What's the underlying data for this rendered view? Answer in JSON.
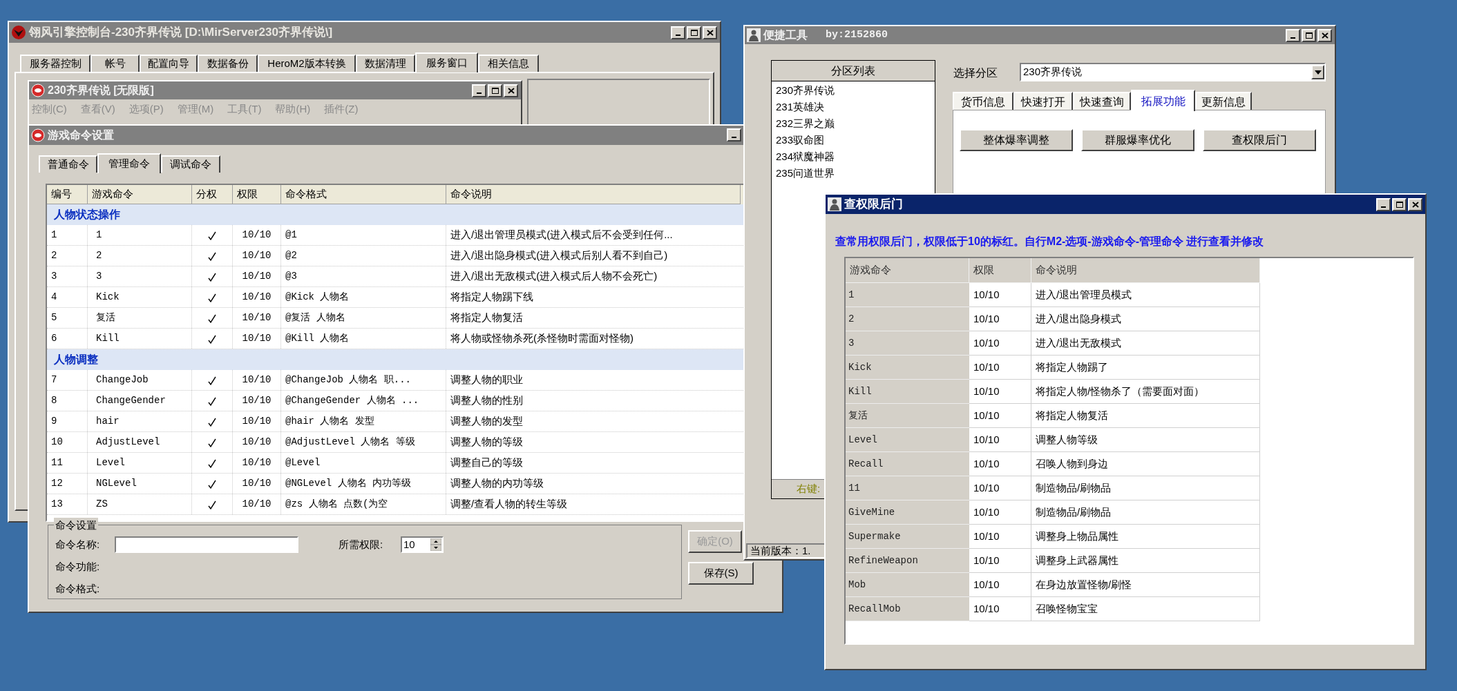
{
  "console_window": {
    "title": "翎风引擎控制台-230齐界传说 [D:\\MirServer230齐界传说\\]",
    "tabs": [
      {
        "label": "服务器控制",
        "selected": false
      },
      {
        "label": "帐号",
        "selected": false
      },
      {
        "label": "配置向导",
        "selected": false
      },
      {
        "label": "数据备份",
        "selected": false
      },
      {
        "label": "HeroM2版本转换",
        "selected": false
      },
      {
        "label": "数据清理",
        "selected": false
      },
      {
        "label": "服务窗口",
        "selected": true
      },
      {
        "label": "相关信息",
        "selected": false
      }
    ]
  },
  "server_window": {
    "title": "230齐界传说 [无限版]",
    "menu": [
      {
        "label": "控制(C)",
        "disabled": true
      },
      {
        "label": "查看(V)",
        "disabled": true
      },
      {
        "label": "选项(P)",
        "disabled": true
      },
      {
        "label": "管理(M)",
        "disabled": true
      },
      {
        "label": "工具(T)",
        "disabled": true
      },
      {
        "label": "帮助(H)",
        "disabled": true
      },
      {
        "label": "插件(Z)",
        "disabled": true
      }
    ]
  },
  "command_window": {
    "title": "游戏命令设置",
    "tabs": [
      {
        "label": "普通命令",
        "selected": false
      },
      {
        "label": "管理命令",
        "selected": true
      },
      {
        "label": "调试命令",
        "selected": false
      }
    ],
    "columns": [
      "编号",
      "游戏命令",
      "分权",
      "权限",
      "命令格式",
      "命令说明"
    ],
    "groups": [
      {
        "title": "人物状态操作",
        "rows": [
          {
            "id": "1",
            "command": "1",
            "split": true,
            "permission": "10/10",
            "format": "@1",
            "description": "进入/退出管理员模式(进入模式后不会受到任何..."
          },
          {
            "id": "2",
            "command": "2",
            "split": true,
            "permission": "10/10",
            "format": "@2",
            "description": "进入/退出隐身模式(进入模式后别人看不到自己)"
          },
          {
            "id": "3",
            "command": "3",
            "split": true,
            "permission": "10/10",
            "format": "@3",
            "description": "进入/退出无敌模式(进入模式后人物不会死亡)"
          },
          {
            "id": "4",
            "command": "Kick",
            "split": true,
            "permission": "10/10",
            "format": "@Kick 人物名",
            "description": "将指定人物踢下线"
          },
          {
            "id": "5",
            "command": "复活",
            "split": true,
            "permission": "10/10",
            "format": "@复活 人物名",
            "description": "将指定人物复活"
          },
          {
            "id": "6",
            "command": "Kill",
            "split": true,
            "permission": "10/10",
            "format": "@Kill 人物名",
            "description": "将人物或怪物杀死(杀怪物时需面对怪物)"
          }
        ]
      },
      {
        "title": "人物调整",
        "rows": [
          {
            "id": "7",
            "command": "ChangeJob",
            "split": true,
            "permission": "10/10",
            "format": "@ChangeJob 人物名 职...",
            "description": "调整人物的职业"
          },
          {
            "id": "8",
            "command": "ChangeGender",
            "split": true,
            "permission": "10/10",
            "format": "@ChangeGender 人物名 ...",
            "description": "调整人物的性别"
          },
          {
            "id": "9",
            "command": "hair",
            "split": true,
            "permission": "10/10",
            "format": "@hair 人物名 发型",
            "description": "调整人物的发型"
          },
          {
            "id": "10",
            "command": "AdjustLevel",
            "split": true,
            "permission": "10/10",
            "format": "@AdjustLevel 人物名 等级",
            "description": "调整人物的等级"
          },
          {
            "id": "11",
            "command": "Level",
            "split": true,
            "permission": "10/10",
            "format": "@Level",
            "description": "调整自己的等级"
          },
          {
            "id": "12",
            "command": "NGLevel",
            "split": true,
            "permission": "10/10",
            "format": "@NGLevel 人物名 内功等级",
            "description": "调整人物的内功等级"
          },
          {
            "id": "13",
            "command": "ZS",
            "split": true,
            "permission": "10/10",
            "format": "@zs 人物名 点数(为空",
            "description": "调整/查看人物的转生等级"
          }
        ]
      }
    ],
    "settings": {
      "legend": "命令设置",
      "name_label": "命令名称:",
      "permission_label": "所需权限:",
      "permission_value": "10",
      "function_label": "命令功能:",
      "format_label": "命令格式:"
    },
    "buttons": [
      {
        "label": "确定(O)",
        "disabled": true
      },
      {
        "label": "保存(S)",
        "disabled": false
      }
    ]
  },
  "tools_window": {
    "title": "便捷工具",
    "author": "by:2152860",
    "partition_list": {
      "header": "分区列表",
      "items": [
        "230齐界传说",
        "231英雄决",
        "232三界之巅",
        "233驭命图",
        "234狱魔神器",
        "235问道世界"
      ],
      "footer": "右键:"
    },
    "select_label": "选择分区",
    "select_value": "230齐界传说",
    "tabs": [
      {
        "label": "货币信息",
        "selected": false
      },
      {
        "label": "快速打开",
        "selected": false
      },
      {
        "label": "快速查询",
        "selected": false
      },
      {
        "label": "拓展功能",
        "selected": true
      },
      {
        "label": "更新信息",
        "selected": false
      }
    ],
    "buttons": [
      "整体爆率调整",
      "群服爆率优化",
      "查权限后门"
    ],
    "status": "当前版本：1."
  },
  "backdoor_dialog": {
    "title": "查权限后门",
    "notice": "查常用权限后门，权限低于10的标红。自行M2-选项-游戏命令-管理命令 进行查看并修改",
    "columns": [
      "游戏命令",
      "权限",
      "命令说明"
    ],
    "rows": [
      {
        "command": "1",
        "permission": "10/10",
        "description": "进入/退出管理员模式"
      },
      {
        "command": "2",
        "permission": "10/10",
        "description": "进入/退出隐身模式"
      },
      {
        "command": "3",
        "permission": "10/10",
        "description": "进入/退出无敌模式"
      },
      {
        "command": "Kick",
        "permission": "10/10",
        "description": "将指定人物踢了"
      },
      {
        "command": "Kill",
        "permission": "10/10",
        "description": "将指定人物/怪物杀了（需要面对面）"
      },
      {
        "command": "复活",
        "permission": "10/10",
        "description": "将指定人物复活"
      },
      {
        "command": "Level",
        "permission": "10/10",
        "description": "调整人物等级"
      },
      {
        "command": "Recall",
        "permission": "10/10",
        "description": "召唤人物到身边"
      },
      {
        "command": "11",
        "permission": "10/10",
        "description": "制造物品/刷物品"
      },
      {
        "command": "GiveMine",
        "permission": "10/10",
        "description": "制造物品/刷物品"
      },
      {
        "command": "Supermake",
        "permission": "10/10",
        "description": "调整身上物品属性"
      },
      {
        "command": "RefineWeapon",
        "permission": "10/10",
        "description": "调整身上武器属性"
      },
      {
        "command": "Mob",
        "permission": "10/10",
        "description": "在身边放置怪物/刷怪"
      },
      {
        "command": "RecallMob",
        "permission": "10/10",
        "description": "召唤怪物宝宝"
      }
    ]
  }
}
